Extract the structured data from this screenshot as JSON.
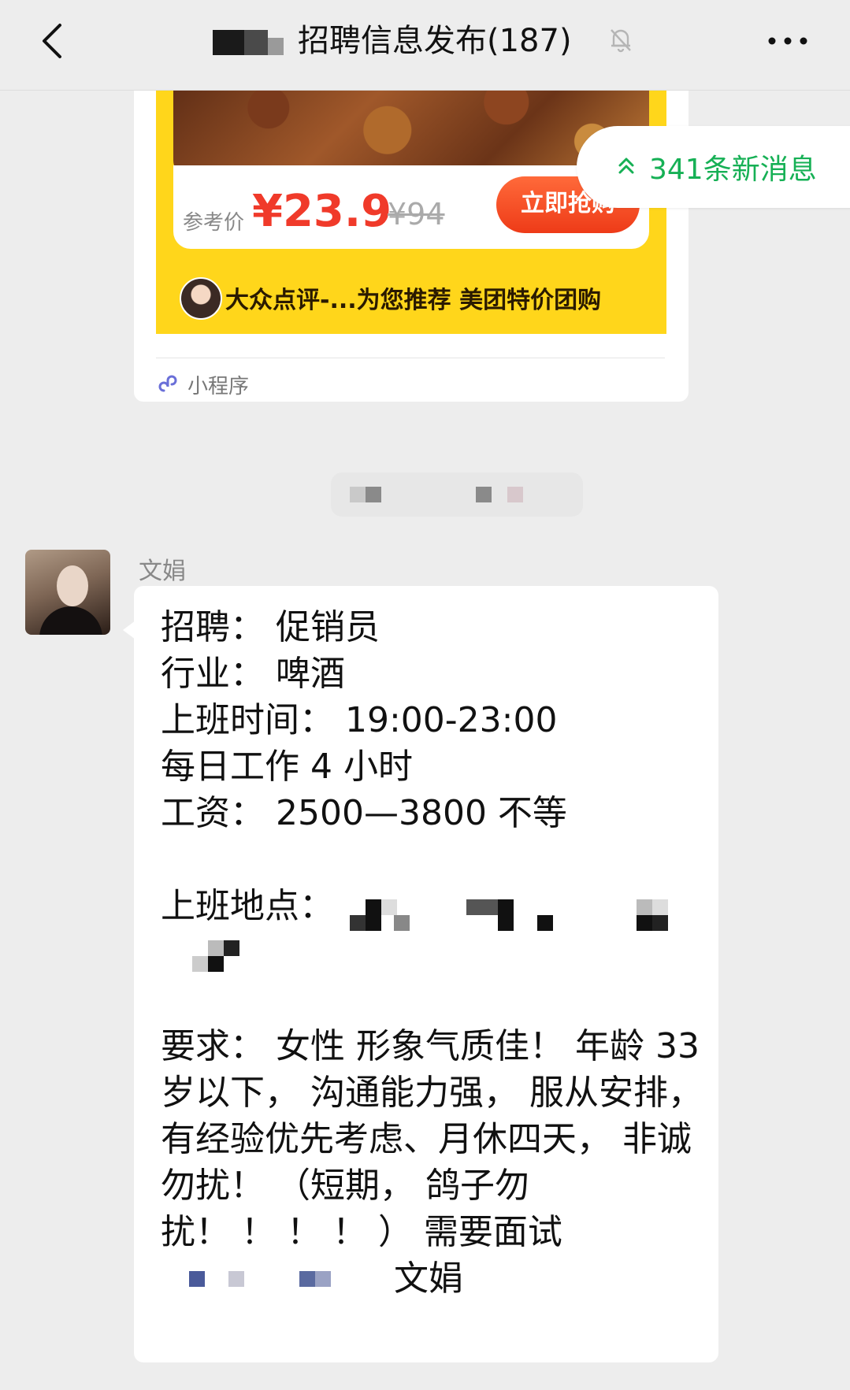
{
  "header": {
    "title": "招聘信息发布(187)",
    "back_icon": "chevron-left-icon",
    "mute_icon": "bell-off-icon",
    "more_icon": "more-horizontal-icon"
  },
  "mini_program": {
    "ref_label": "参考价",
    "price": "¥23.9",
    "old_price": "¥94",
    "buy_label": "立即抢购",
    "source": "大众点评-...为您推荐 美团特价团购",
    "type_label": "小程序"
  },
  "new_messages": {
    "label": "341条新消息",
    "color": "#16b055"
  },
  "message": {
    "sender": "文娟",
    "lines": [
      "招聘：  促销员",
      "行业：  啤酒",
      "上班时间：  19:00-23:00",
      "每日工作 4 小时",
      "工资：  2500—3800 不等",
      "上班地点：",
      "要求：  女性 形象气质佳！  年龄 33",
      "岁以下，  沟通能力强，  服从安排，",
      "有经验优先考虑、月休四天，  非诚",
      "勿扰！  （短期，  鸽子勿",
      "扰！  ！  ！  ！  ）  需要面试",
      "文娟"
    ]
  }
}
